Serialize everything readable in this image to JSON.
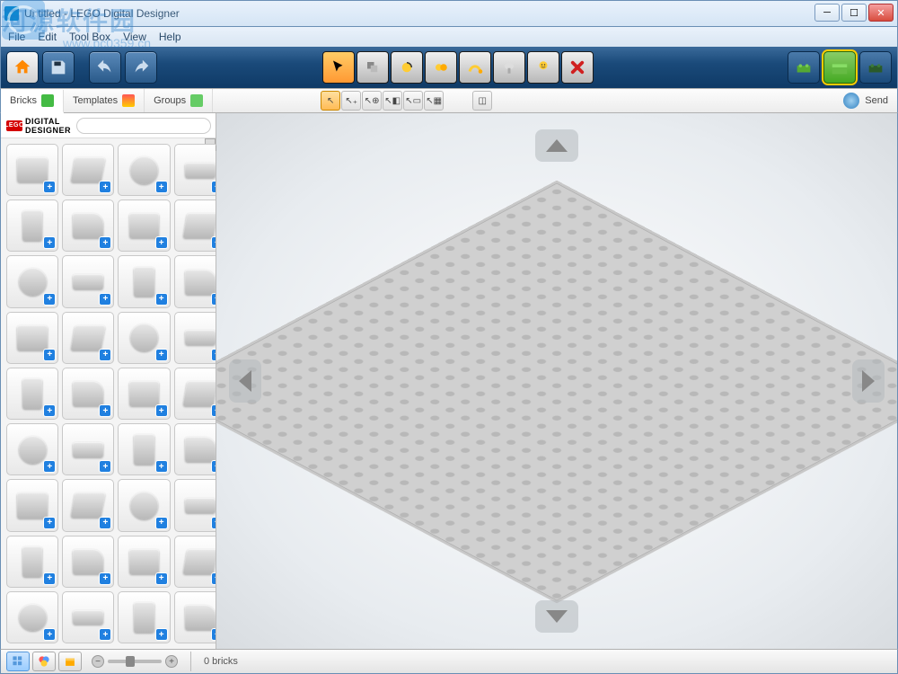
{
  "window": {
    "title": "Untitled - LEGO Digital Designer"
  },
  "menu": {
    "items": [
      "File",
      "Edit",
      "Tool Box",
      "View",
      "Help"
    ]
  },
  "watermark": {
    "text": "河源软件园",
    "url": "www.pc0359.cn"
  },
  "tabs": {
    "bricks": "Bricks",
    "templates": "Templates",
    "groups": "Groups"
  },
  "sidebar": {
    "brand_square": "LEGO",
    "brand_text": "DIGITAL DESIGNER",
    "search_placeholder": ""
  },
  "send": {
    "label": "Send"
  },
  "status": {
    "brick_count": "0 bricks"
  },
  "brick_palette_count": 36
}
